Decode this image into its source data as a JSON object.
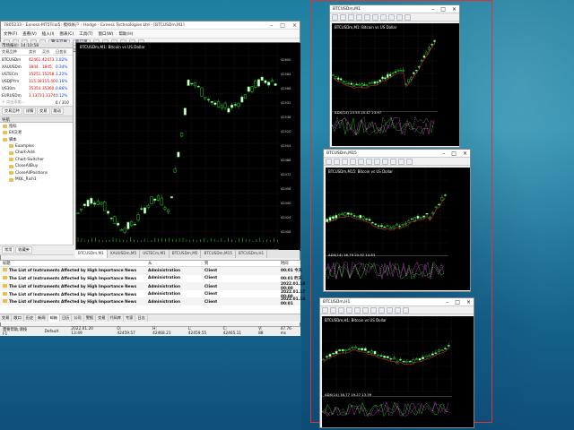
{
  "main": {
    "title": "7805233 - Exness-MT5Trial5: 模拟帐户 - Hedge - Exness Technologies Ltd - [BTCUSDm,M1]",
    "menu": [
      "文件(F)",
      "查看(V)",
      "插入(I)",
      "图表(C)",
      "工具(T)",
      "窗口(W)",
      "帮助(H)"
    ],
    "toolbar": [
      "算法交易",
      "新订单"
    ],
    "timeframes": [
      "M1",
      "M5",
      "M15",
      "M30",
      "H1",
      "H4",
      "D1",
      "W1",
      "MN"
    ],
    "mw_title": "市场报价: 14:10:58",
    "mw_headers": [
      "交易品种",
      "卖价",
      "买价",
      "日变化"
    ],
    "mw_rows": [
      [
        "BTCUSDm",
        "42461.",
        "42473.",
        "1.82%"
      ],
      [
        "XAUUSDm",
        "1844.",
        "1845.",
        "0.34%"
      ],
      [
        "USTECm",
        "15251.",
        "15258.",
        "1.22%"
      ],
      [
        "USDJPYm",
        "115.38",
        "115.40",
        "0.16%"
      ],
      [
        "US30m",
        "35354.",
        "35360.",
        "0.86%"
      ],
      [
        "EURUSDm",
        "1.1373",
        "1.1374",
        "0.12%"
      ]
    ],
    "mw_add": "+ 点击添加...",
    "mw_count": "6 / 310",
    "mw_tabs": [
      "交易品种",
      "详情",
      "交易",
      "跳动"
    ],
    "nav_title": "导航",
    "nav_items": [
      "指标",
      "EA交易",
      "脚本",
      "Examples",
      "Chart-Add",
      "Chart-Switcher",
      "CloseAllBuy",
      "CloseAllPositions",
      "MQL_Rich1"
    ],
    "nav_tabs": [
      "常用",
      "收藏夹"
    ],
    "chart_label": "BTCUSDm,M1: Bitcoin vs US Dollar",
    "chart_tabs": [
      "BTCUSDm,M1",
      "XAUUSDm,M5",
      "USTECm,M1",
      "BTCUSDm,M5",
      "BTCUSDm,M15",
      "BTCUSDm,H1"
    ],
    "tb_headers": [
      "标题",
      "从",
      "到",
      "时间"
    ],
    "tb_rows": [
      [
        "The List of Instruments Affected by High Importance News",
        "Administration",
        "Client",
        "00:01",
        "今天"
      ],
      [
        "The List of Instruments Affected by High Importance News",
        "Administration",
        "Client",
        "00:01",
        "昨天"
      ],
      [
        "The List of Instruments Affected by High Importance News",
        "Administration",
        "Client",
        "2022.01.18 00:00",
        ""
      ],
      [
        "The List of Instruments Affected by High Importance News",
        "Administration",
        "Client",
        "2022.01.17 00:00",
        ""
      ],
      [
        "The List of Instruments Affected by High Importance News",
        "Administration",
        "Client",
        "2022.01.14 00:01",
        ""
      ]
    ],
    "bottom_tabs": [
      "交易",
      "敞口",
      "历史",
      "新闻",
      "邮箱",
      "日历",
      "公司",
      "警报",
      "交易",
      "代码库",
      "专家",
      "日志"
    ],
    "status": [
      "需要帮助,请按 F1",
      "Default",
      "2022.01.20 13:49",
      "O: 42459.57",
      "H: 42468.21",
      "L: 42459.55",
      "C: 42465.11",
      "V: 88",
      "47.76 ms"
    ]
  },
  "windows": [
    {
      "title": "BTCUSDm,M1",
      "label": "BTCUSDm,M1: Bitcoin vs US Dollar",
      "ind": "ADX(14) 23.55 25.47 23.97"
    },
    {
      "title": "BTCUSDm,M15",
      "label": "BTCUSDm,M15: Bitcoin vs US Dollar",
      "ind": "ADX(14) 16.79 20.92 14.83"
    },
    {
      "title": "BTCUSDm,H1",
      "label": "BTCUSDm,H1: Bitcoin vs US Dollar",
      "ind": "ADX(14) 16.77 19.27 13.59"
    }
  ]
}
